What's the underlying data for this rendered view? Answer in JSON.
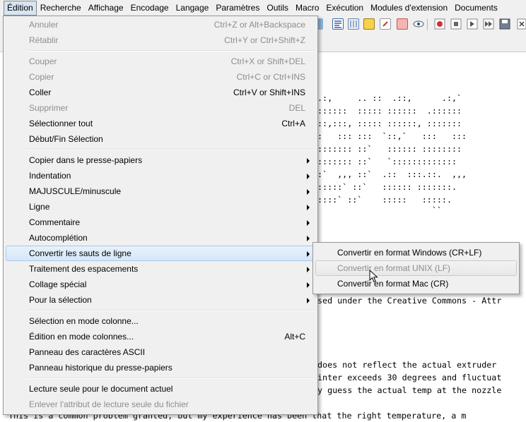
{
  "menubar": {
    "items": [
      "Édition",
      "Recherche",
      "Affichage",
      "Encodage",
      "Langage",
      "Paramètres",
      "Outils",
      "Macro",
      "Exécution",
      "Modules d'extension",
      "Documents"
    ]
  },
  "editor": {
    "ascii_lines": [
      ".:,     .. ::  .::,      .:,`",
      "::::::  ::::: ::::::  .:::::: ",
      "::,:::, ::::: ::::::, :::::::",
      ":   ::: :::  `::,`   :::   :::",
      "::::::: ::`   :::::: ::::::::",
      "::::::: ::`   `:::::::::::::",
      ":`  ,,, ::`  .::  :::.::.  ,,,",
      ":::::` ::`   :::::: :::::::.",
      "::::` ::`    :::::   :::::.",
      "                       ``"
    ],
    "text_lines": [
      "sed under the Creative Commons - Attr",
      "does not reflect the actual extruder ",
      "inter exceeds 30 degrees and fluctuat",
      "y guess the actual temp at the nozzle",
      "This is a common problem granted, but my experience has been that the right temperature, a m"
    ]
  },
  "menu": {
    "items": [
      {
        "label": "Annuler",
        "shortcut": "Ctrl+Z or Alt+Backspace",
        "disabled": true
      },
      {
        "label": "Rétablir",
        "shortcut": "Ctrl+Y or Ctrl+Shift+Z",
        "disabled": true
      },
      {
        "label": "Couper",
        "shortcut": "Ctrl+X or Shift+DEL",
        "disabled": true
      },
      {
        "label": "Copier",
        "shortcut": "Ctrl+C or Ctrl+INS",
        "disabled": true
      },
      {
        "label": "Coller",
        "shortcut": "Ctrl+V or Shift+INS",
        "disabled": false
      },
      {
        "label": "Supprimer",
        "shortcut": "DEL",
        "disabled": true
      },
      {
        "label": "Sélectionner tout",
        "shortcut": "Ctrl+A",
        "disabled": false
      },
      {
        "label": "Début/Fin Sélection",
        "shortcut": "",
        "disabled": false
      },
      {
        "label": "Copier dans le presse-papiers",
        "shortcut": "",
        "disabled": false,
        "submenu": true
      },
      {
        "label": "Indentation",
        "shortcut": "",
        "disabled": false,
        "submenu": true
      },
      {
        "label": "MAJUSCULE/minuscule",
        "shortcut": "",
        "disabled": false,
        "submenu": true
      },
      {
        "label": "Ligne",
        "shortcut": "",
        "disabled": false,
        "submenu": true
      },
      {
        "label": "Commentaire",
        "shortcut": "",
        "disabled": false,
        "submenu": true
      },
      {
        "label": "Autocomplétion",
        "shortcut": "",
        "disabled": false,
        "submenu": true
      },
      {
        "label": "Convertir les sauts de ligne",
        "shortcut": "",
        "disabled": false,
        "submenu": true,
        "highlighted": true
      },
      {
        "label": "Traitement des espacements",
        "shortcut": "",
        "disabled": false,
        "submenu": true
      },
      {
        "label": "Collage spécial",
        "shortcut": "",
        "disabled": false,
        "submenu": true
      },
      {
        "label": "Pour la sélection",
        "shortcut": "",
        "disabled": false,
        "submenu": true
      },
      {
        "label": "Sélection en mode colonne...",
        "shortcut": "",
        "disabled": false
      },
      {
        "label": "Édition en mode colonnes...",
        "shortcut": "Alt+C",
        "disabled": false
      },
      {
        "label": "Panneau des caractères ASCII",
        "shortcut": "",
        "disabled": false
      },
      {
        "label": "Panneau historique du presse-papiers",
        "shortcut": "",
        "disabled": false
      },
      {
        "label": "Lecture seule pour le document actuel",
        "shortcut": "",
        "disabled": false
      },
      {
        "label": "Enlever l'attribut de lecture seule du fichier",
        "shortcut": "",
        "disabled": true
      }
    ]
  },
  "submenu": {
    "items": [
      {
        "label": "Convertir en format Windows (CR+LF)",
        "disabled": false
      },
      {
        "label": "Convertir en format UNIX (LF)",
        "disabled": true,
        "hovered": true
      },
      {
        "label": "Convertir en format Mac (CR)",
        "disabled": false
      }
    ]
  },
  "colors": {
    "menu_bg": "#f0f0f0",
    "highlight": "#d6e7f8",
    "disabled_text": "#8d8d8d"
  }
}
